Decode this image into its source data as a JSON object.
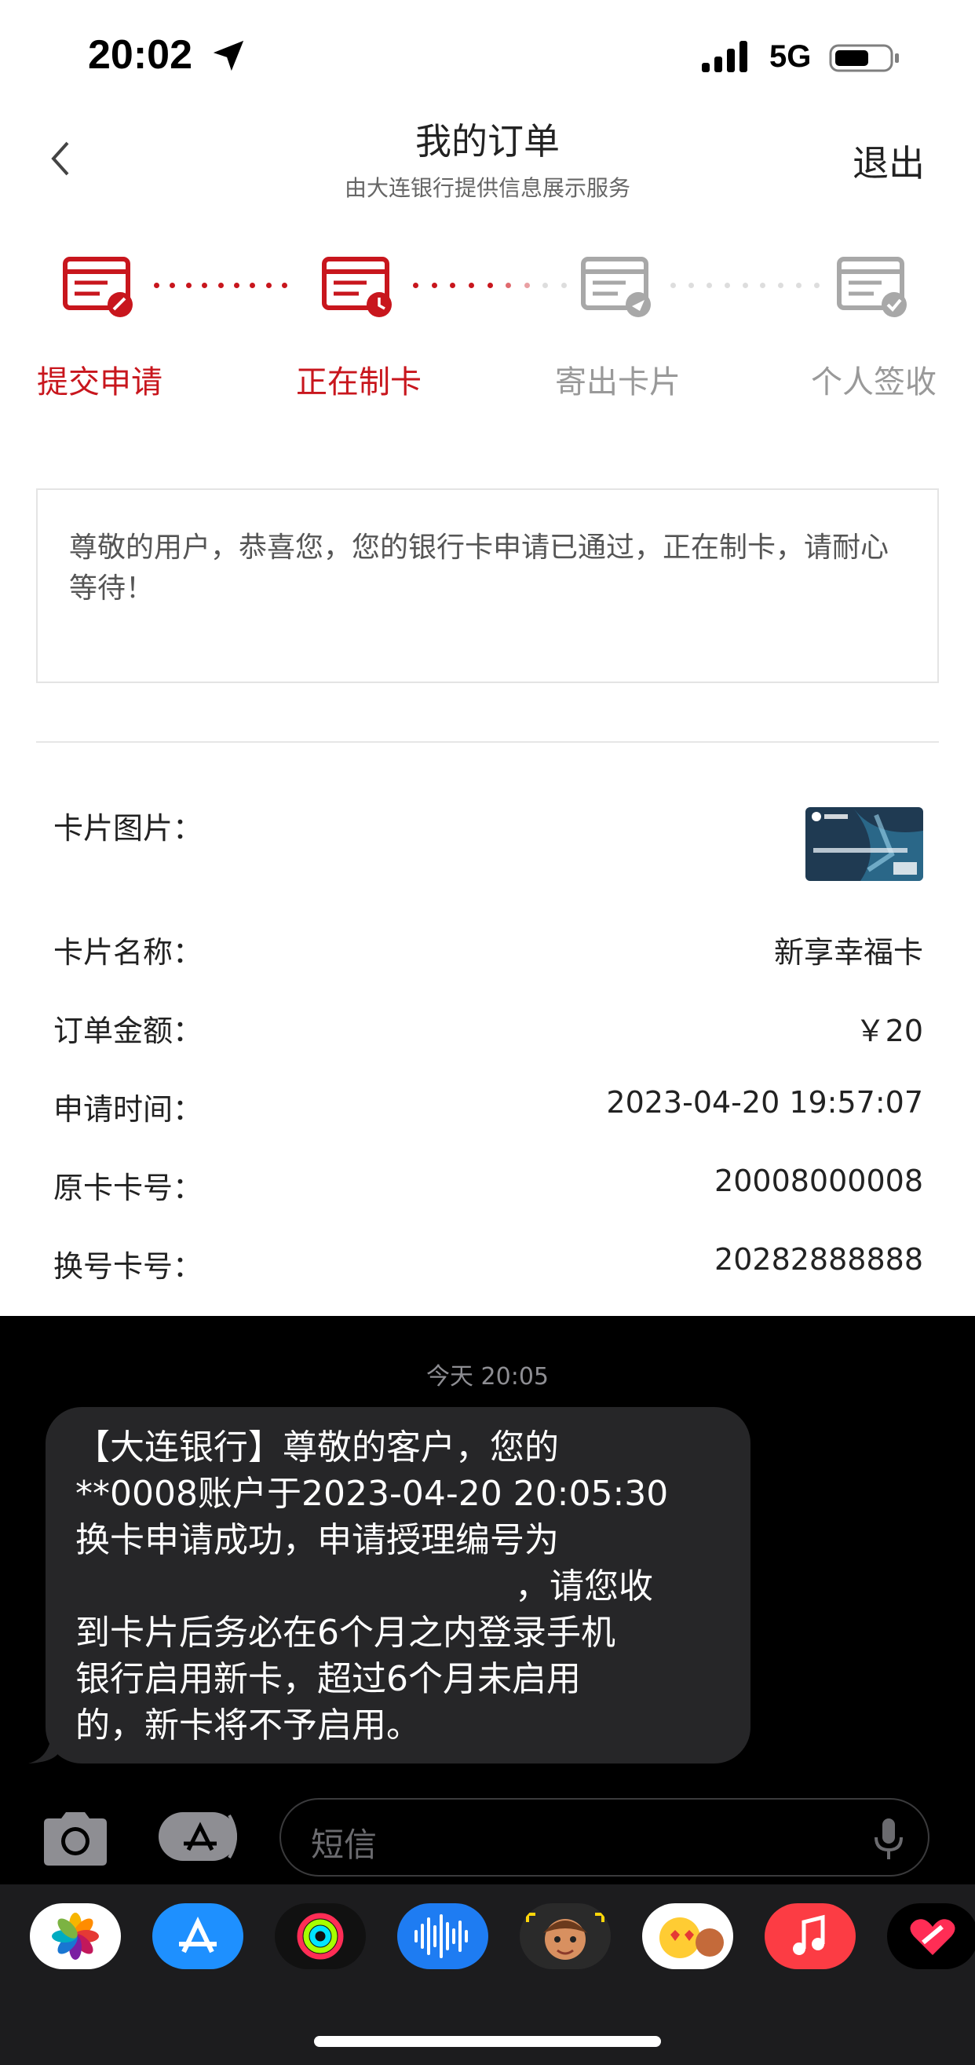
{
  "status_bar": {
    "time": "20:02",
    "network": "5G"
  },
  "header": {
    "title": "我的订单",
    "subtitle": "由大连银行提供信息展示服务",
    "logout_label": "退出"
  },
  "steps": [
    {
      "label": "提交申请",
      "state": "done",
      "icon": "form-edit-icon"
    },
    {
      "label": "正在制卡",
      "state": "current",
      "icon": "form-clock-icon"
    },
    {
      "label": "寄出卡片",
      "state": "pending",
      "icon": "form-send-icon"
    },
    {
      "label": "个人签收",
      "state": "pending",
      "icon": "form-check-icon"
    }
  ],
  "notice": "尊敬的用户，恭喜您，您的银行卡申请已通过，正在制卡，请耐心等待！",
  "order": {
    "card_image_label": "卡片图片：",
    "rows": [
      {
        "key": "卡片名称：",
        "value": "新享幸福卡"
      },
      {
        "key": "订单金额：",
        "value": "￥20"
      },
      {
        "key": "申请时间：",
        "value": "2023-04-20 19:57:07"
      },
      {
        "key": "原卡卡号：",
        "value": "20008000008"
      },
      {
        "key": "换号卡号：",
        "value": "20282888888"
      }
    ]
  },
  "messages": {
    "timestamp": "今天 20:05",
    "bubble_lines": [
      "【大连银行】尊敬的客户，您的",
      "**0008账户于2023-04-20 20:05:30",
      "换卡申请成功，申请授理编号为",
      "，请您收",
      "到卡片后务必在6个月之内登录手机",
      "银行启用新卡，超过6个月未启用",
      "的，新卡将不予启用。"
    ]
  },
  "compose": {
    "placeholder": "短信"
  },
  "app_drawer": [
    "photos-icon",
    "app-store-icon",
    "activity-icon",
    "audio-message-icon",
    "memoji-icon",
    "animoji-icon",
    "music-icon",
    "fitness-icon"
  ],
  "colors": {
    "accent_red": "#c8161d",
    "pending_grey": "#999999"
  }
}
